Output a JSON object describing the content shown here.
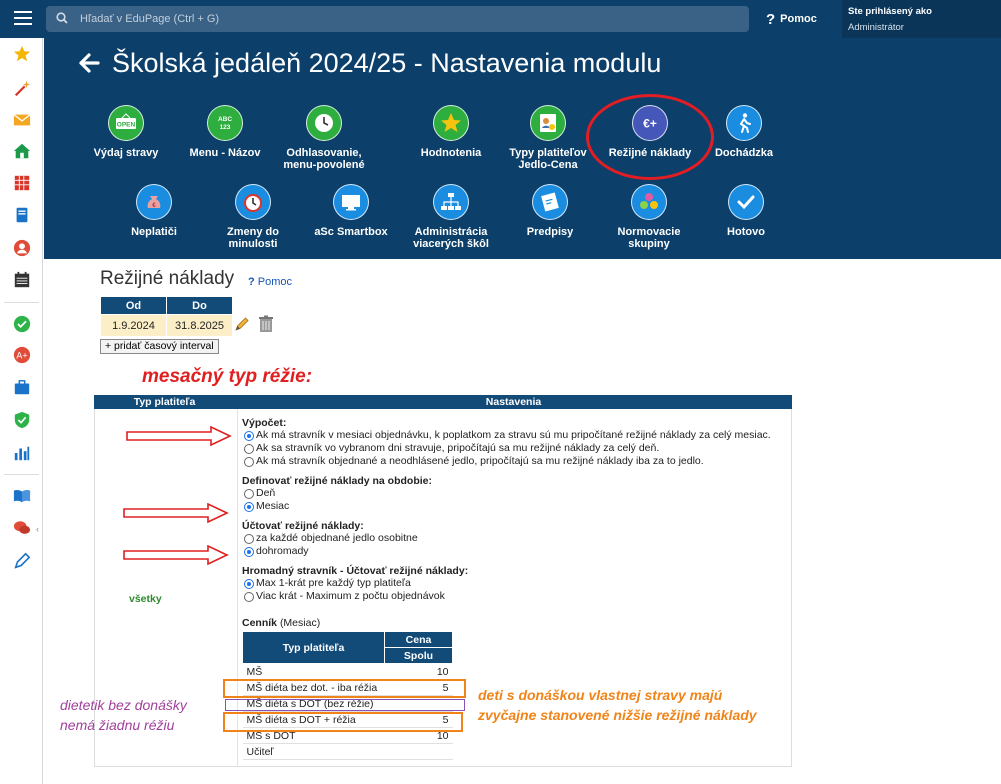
{
  "topbar": {
    "search_placeholder": "Hľadať v EduPage (Ctrl + G)",
    "help_label": "Pomoc",
    "user_line1": "Ste prihlásený ako",
    "user_line2": "Administrátor"
  },
  "header": {
    "title": "Školská jedáleň 2024/25 - Nastavenia modulu",
    "modules_row1": [
      {
        "icon": "open-sign-icon",
        "label": "Výdaj stravy"
      },
      {
        "icon": "abc-123-icon",
        "label": "Menu - Názov"
      },
      {
        "icon": "clock-icon",
        "label": "Odhlasovanie, menu-povolené"
      },
      {
        "icon": "star-icon",
        "label": "Hodnotenia"
      },
      {
        "icon": "payer-types-icon",
        "label": "Typy platiteľov Jedlo-Cena"
      },
      {
        "icon": "euro-plus-icon",
        "label": "Režijné náklady"
      },
      {
        "icon": "walking-person-icon",
        "label": "Dochádzka"
      }
    ],
    "modules_row2": [
      {
        "icon": "money-bag-icon",
        "label": "Neplatiči"
      },
      {
        "icon": "alarm-clock-icon",
        "label": "Zmeny do minulosti"
      },
      {
        "icon": "monitor-icon",
        "label": "aSc Smartbox"
      },
      {
        "icon": "hierarchy-icon",
        "label": "Administrácia viacerých škôl"
      },
      {
        "icon": "prescription-icon",
        "label": "Predpisy"
      },
      {
        "icon": "colored-dots-icon",
        "label": "Normovacie skupiny"
      },
      {
        "icon": "checkmark-icon",
        "label": "Hotovo"
      }
    ]
  },
  "content": {
    "title": "Režijné náklady",
    "help": "Pomoc",
    "interval": {
      "col_from": "Od",
      "col_to": "Do",
      "from": "1.9.2024",
      "to": "31.8.2025"
    },
    "add_interval": "+ pridať časový interval",
    "annotation_top": "mesačný typ réžie:",
    "settings_header": {
      "col1": "Typ platiteľa",
      "col2": "Nastavenia"
    },
    "payer_label": "všetky",
    "groups": [
      {
        "title": "Výpočet:",
        "options": [
          {
            "label": "Ak má stravník v mesiaci objednávku, k poplatkom za stravu sú mu pripočítané režijné náklady za celý mesiac.",
            "selected": true
          },
          {
            "label": "Ak sa stravník vo vybranom dni stravuje, pripočítajú sa mu režijné náklady za celý deň.",
            "selected": false
          },
          {
            "label": "Ak má stravník objednané a neodhlásené jedlo, pripočítajú sa mu režijné náklady iba za to jedlo.",
            "selected": false
          }
        ]
      },
      {
        "title": "Definovať režijné náklady na obdobie:",
        "options": [
          {
            "label": "Deň",
            "selected": false
          },
          {
            "label": "Mesiac",
            "selected": true
          }
        ]
      },
      {
        "title": "Účtovať režijné náklady:",
        "options": [
          {
            "label": "za každé objednané jedlo osobitne",
            "selected": false
          },
          {
            "label": "dohromady",
            "selected": true
          }
        ]
      },
      {
        "title": "Hromadný stravník - Účtovať režijné náklady:",
        "options": [
          {
            "label": "Max 1-krát pre každý typ platiteľa",
            "selected": true
          },
          {
            "label": "Viac krát - Maximum z počtu objednávok",
            "selected": false
          }
        ]
      }
    ],
    "cennik_label": "Cenník",
    "cennik_sub": "(Mesiac)",
    "price_table": {
      "col_type": "Typ platiteľa",
      "col_price": "Cena",
      "col_total": "Spolu",
      "rows": [
        {
          "type": "MŠ",
          "value": "10"
        },
        {
          "type": "MŠ diéta bez dot. - iba réžia",
          "value": "5"
        },
        {
          "type": "MŠ diéta s DOT (bez réžie)",
          "value": ""
        },
        {
          "type": "MŠ diéta s DOT + réžia",
          "value": "5"
        },
        {
          "type": "MŠ s DOT",
          "value": "10"
        },
        {
          "type": "Učiteľ",
          "value": ""
        }
      ]
    },
    "annotation_orange_1": "deti s donáškou vlastnej stravy majú",
    "annotation_orange_2": "zvyčajne stanovené nižšie režijné náklady",
    "annotation_purple_1": "dietetik bez donášky",
    "annotation_purple_2": "nemá žiadnu réžiu"
  },
  "colors": {
    "header_bg": "#0c3f69",
    "table_header": "#124a78",
    "annotation_red": "#e02020",
    "annotation_orange": "#f08418",
    "annotation_purple": "#a13f9c"
  }
}
